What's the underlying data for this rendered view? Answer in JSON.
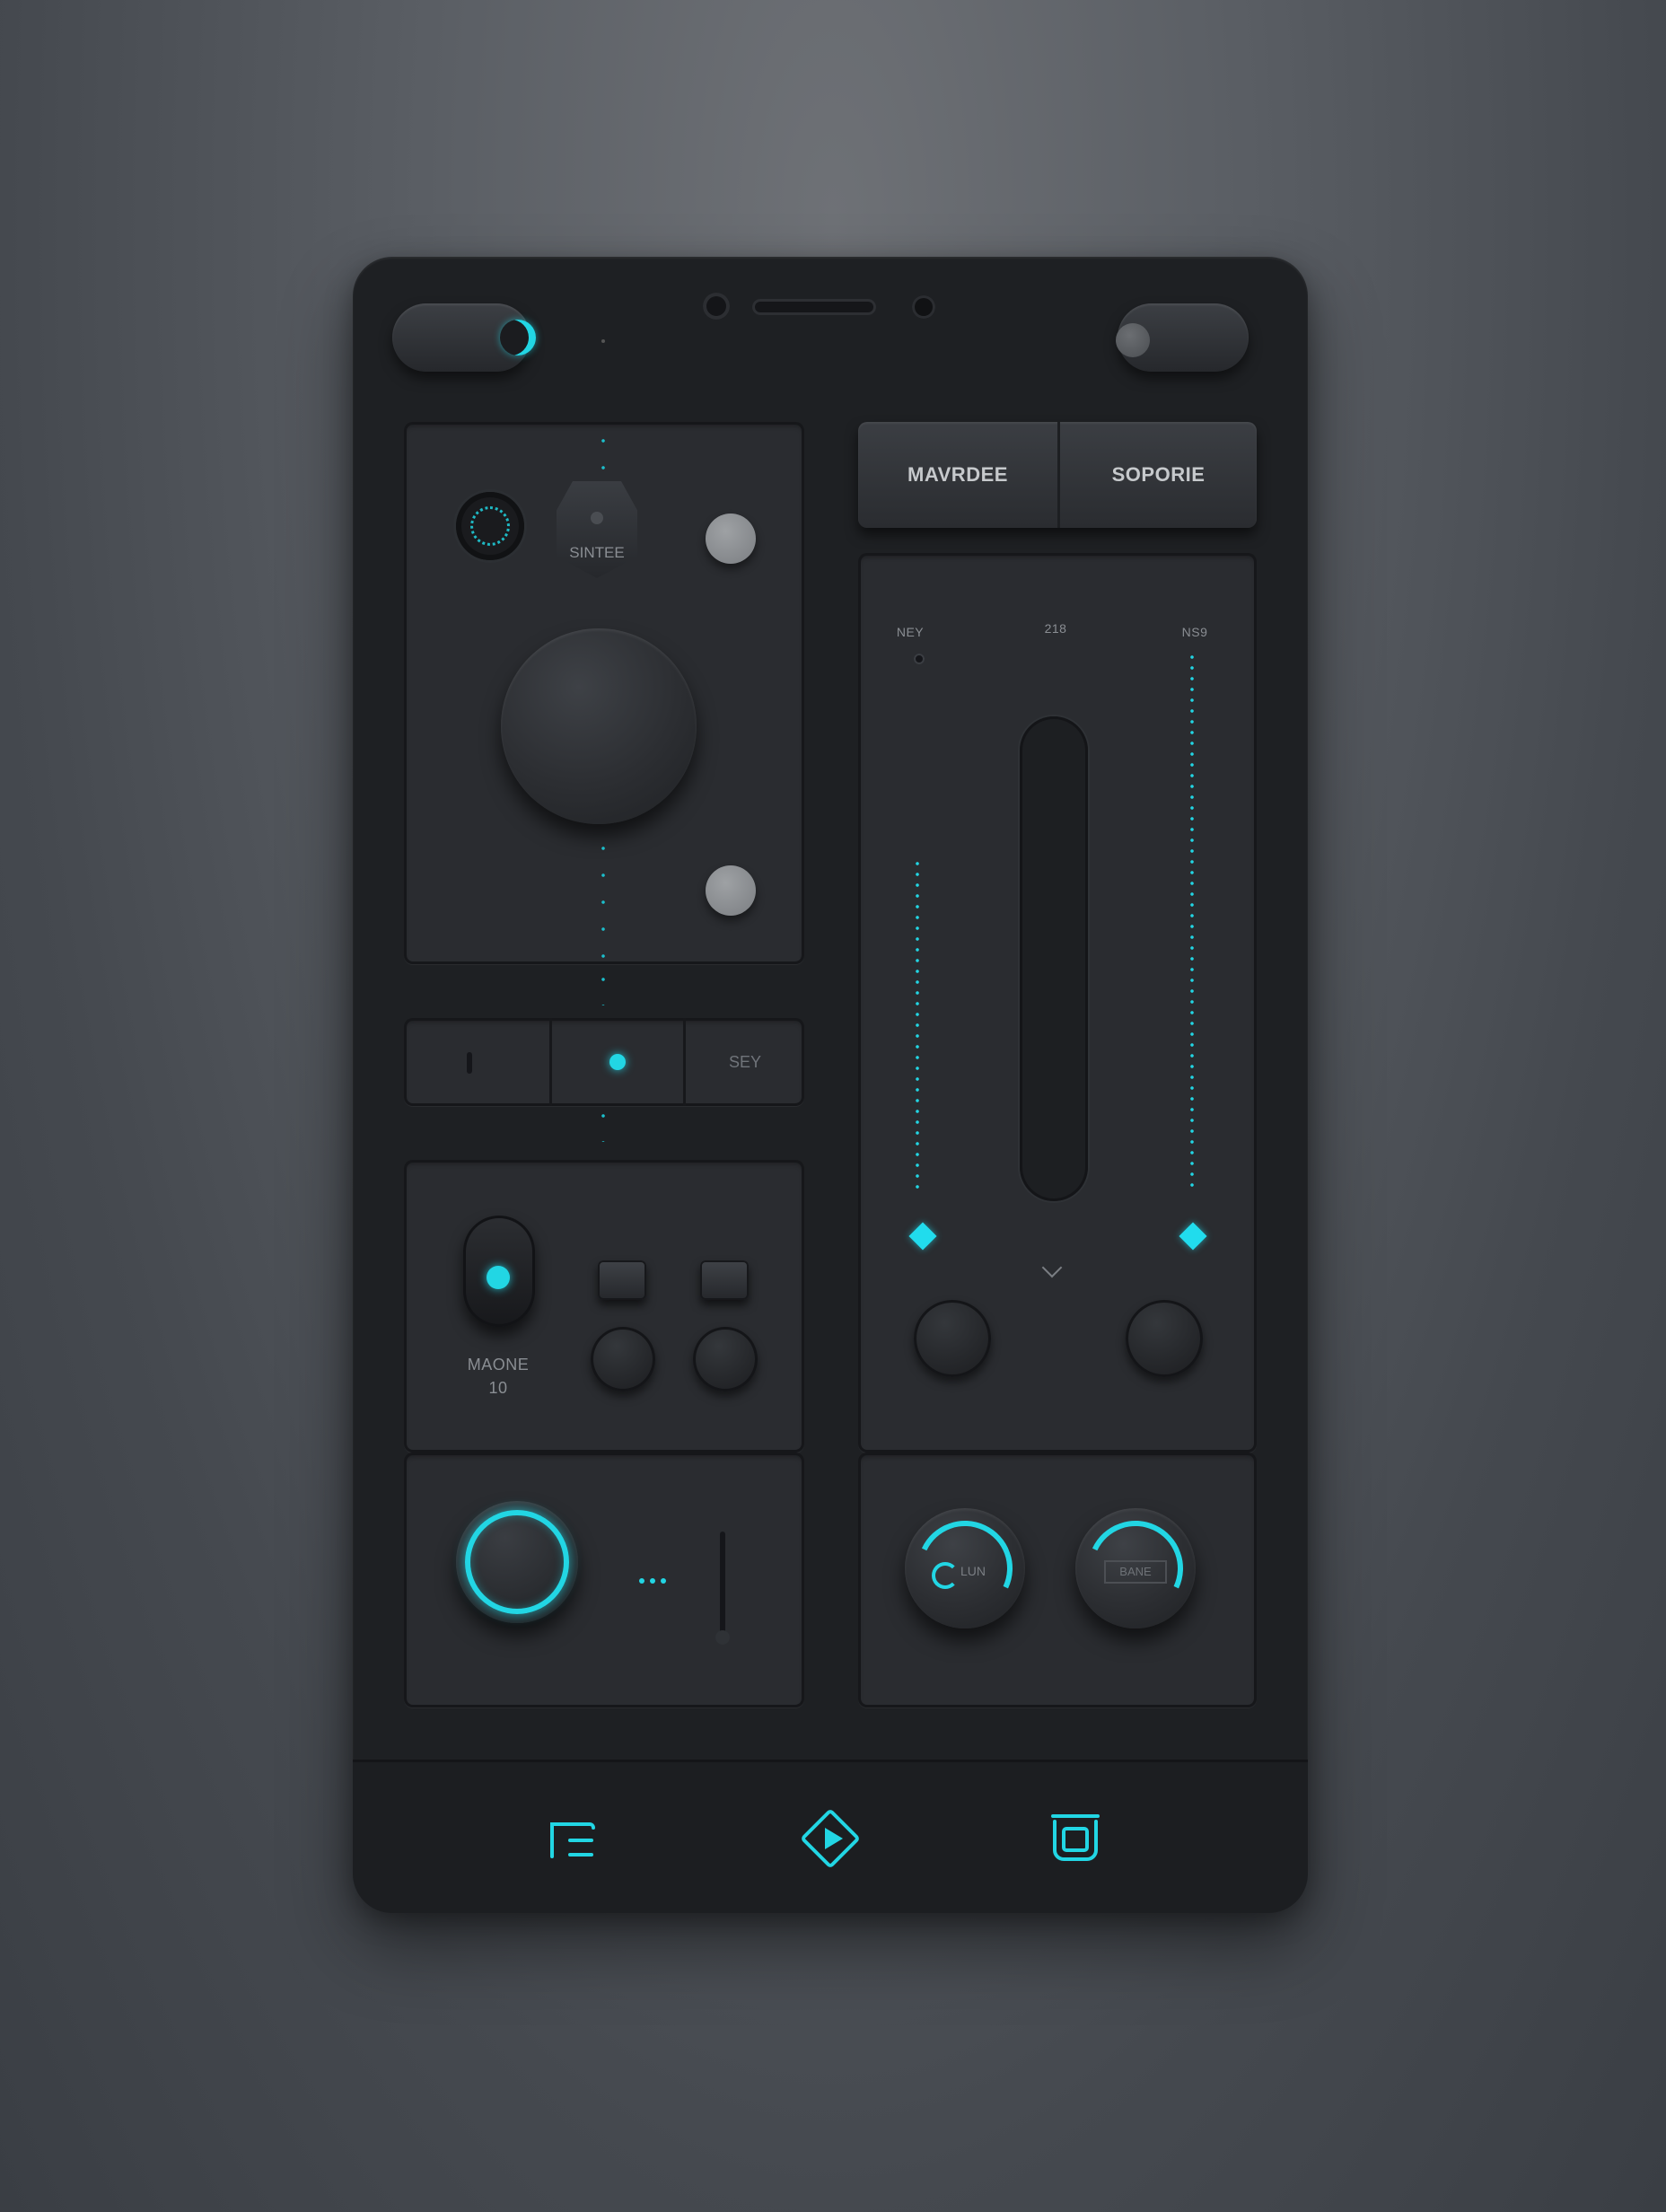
{
  "colors": {
    "accent": "#22d6e4",
    "device_body": "#1e2023",
    "panel": "#2a2c30",
    "text_muted": "#8a8e93",
    "background": "#5a5e64"
  },
  "top_left_panel": {
    "center_badge": "SINTEE"
  },
  "segment_bar": {
    "right_label": "SEY"
  },
  "tabs": [
    {
      "label": "MAVRDEE"
    },
    {
      "label": "SOPORIE"
    }
  ],
  "mixer": {
    "left_label": "NEY",
    "center_label": "218",
    "right_label": "NS9"
  },
  "switch_panel": {
    "label": "MAONE",
    "value": "10"
  },
  "dials": {
    "left_inner_label": "LUN",
    "right_inner_label": "BANE"
  },
  "bottom_nav": {
    "items": [
      {
        "icon": "layout-icon"
      },
      {
        "icon": "play-diamond-icon"
      },
      {
        "icon": "frame-icon"
      }
    ]
  }
}
